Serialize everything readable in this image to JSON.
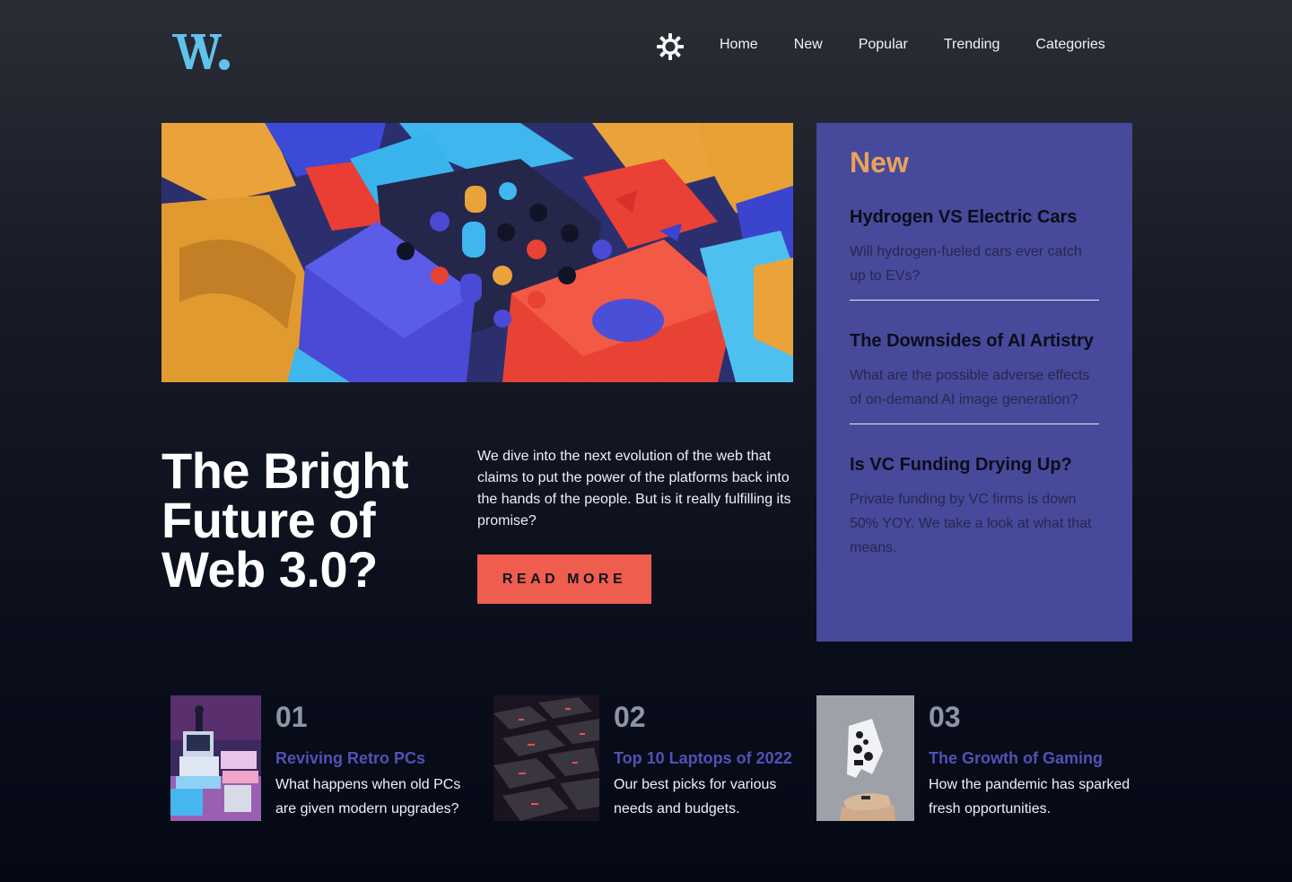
{
  "brand": {
    "logo_text": "W",
    "accent": "#60c3ea"
  },
  "nav": {
    "theme_toggle_icon": "sun-icon",
    "items": [
      "Home",
      "New",
      "Popular",
      "Trending",
      "Categories"
    ]
  },
  "hero": {
    "title": "The Bright Future of Web 3.0?",
    "description": "We dive into the next evolution of the web that claims to put the power of the platforms back into the hands of the people. But is it really fulfilling its promise?",
    "button_label": "READ MORE",
    "button_color": "#ef5d4f"
  },
  "new_panel": {
    "heading": "New",
    "heading_color": "#e9a25a",
    "background": "#47499a",
    "items": [
      {
        "title": "Hydrogen VS Electric Cars",
        "description": "Will hydrogen-fueled cars ever catch up to EVs?"
      },
      {
        "title": "The Downsides of AI Artistry",
        "description": "What are the possible adverse effects of on-demand AI image generation?"
      },
      {
        "title": "Is VC Funding Drying Up?",
        "description": "Private funding by VC firms is down 50% YOY. We take a look at what that means."
      }
    ]
  },
  "cards": [
    {
      "number": "01",
      "title": "Reviving Retro PCs",
      "description": "What happens when old PCs are given modern upgrades?"
    },
    {
      "number": "02",
      "title": "Top 10 Laptops of 2022",
      "description": "Our best picks for various needs and budgets."
    },
    {
      "number": "03",
      "title": "The Growth of Gaming",
      "description": "How the pandemic has sparked fresh opportunities."
    }
  ]
}
